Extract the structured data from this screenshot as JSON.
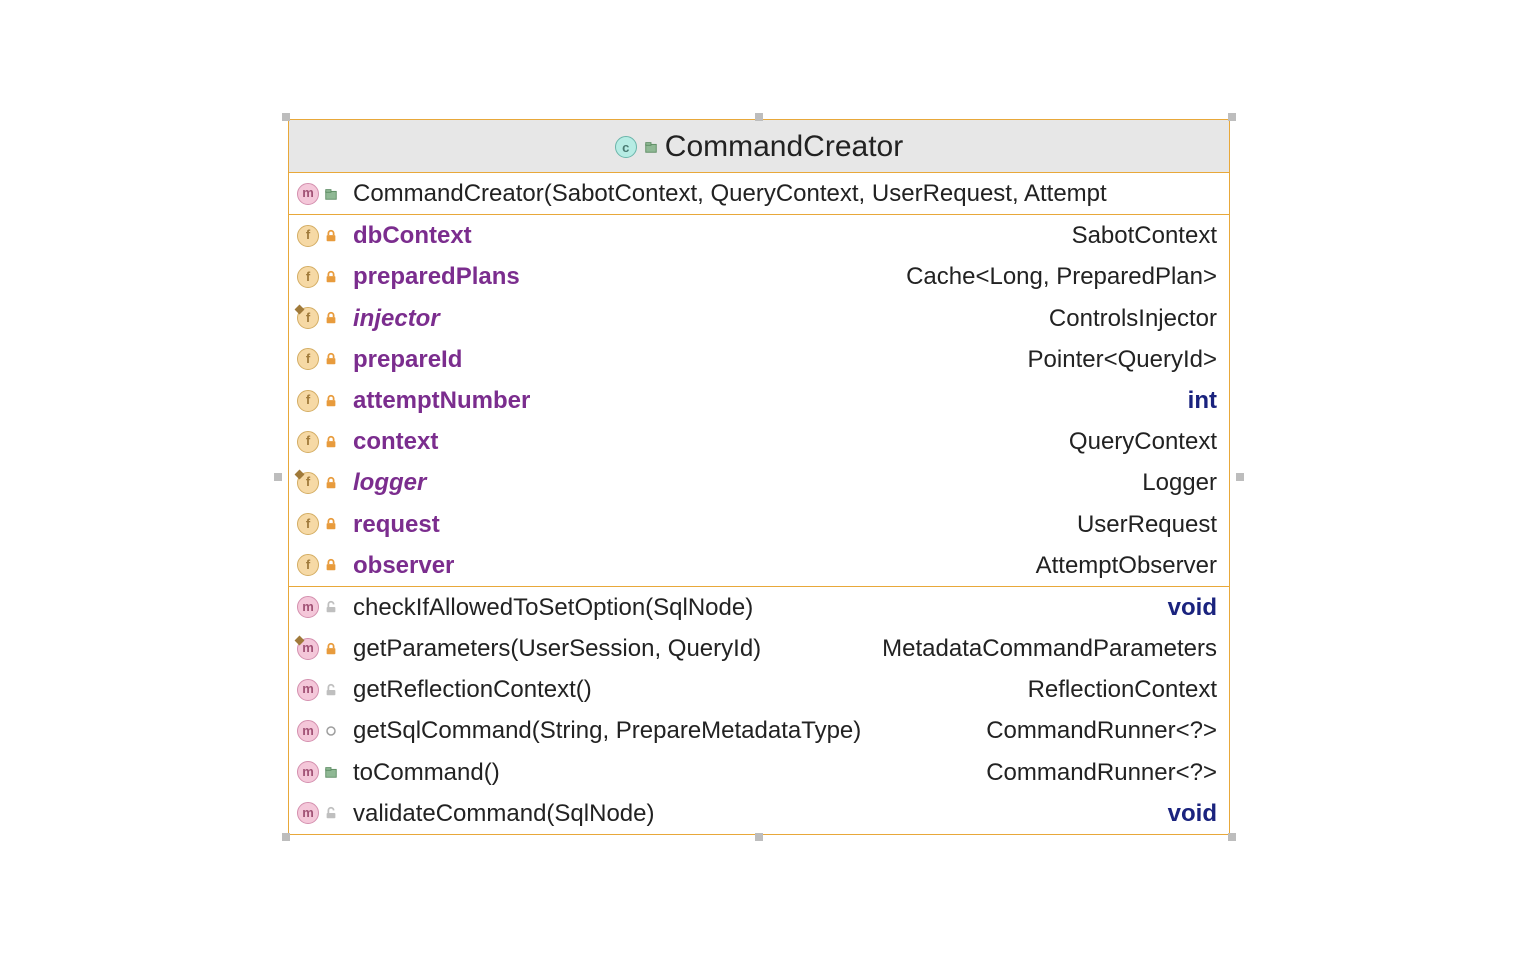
{
  "class": {
    "name": "CommandCreator",
    "kind_icon": "c"
  },
  "members": [
    {
      "icon": "m",
      "vis": "package",
      "name": "CommandCreator(SabotContext, QueryContext, UserRequest, Attempt",
      "type": "",
      "style": "method",
      "section_start": false
    },
    {
      "icon": "f",
      "vis": "lock",
      "name": "dbContext",
      "type": "SabotContext",
      "style": "field",
      "section_start": true
    },
    {
      "icon": "f",
      "vis": "lock",
      "name": "preparedPlans",
      "type": "Cache<Long, PreparedPlan>",
      "style": "field"
    },
    {
      "icon": "f",
      "vis": "lock",
      "name": "injector",
      "type": "ControlsInjector",
      "style": "field",
      "italic": true,
      "static": true
    },
    {
      "icon": "f",
      "vis": "lock",
      "name": "prepareId",
      "type": "Pointer<QueryId>",
      "style": "field"
    },
    {
      "icon": "f",
      "vis": "lock",
      "name": "attemptNumber",
      "type": "int",
      "style": "field",
      "primitive": true
    },
    {
      "icon": "f",
      "vis": "lock",
      "name": "context",
      "type": "QueryContext",
      "style": "field"
    },
    {
      "icon": "f",
      "vis": "lock",
      "name": "logger",
      "type": "Logger",
      "style": "field",
      "italic": true,
      "static": true
    },
    {
      "icon": "f",
      "vis": "lock",
      "name": "request",
      "type": "UserRequest",
      "style": "field"
    },
    {
      "icon": "f",
      "vis": "lock",
      "name": "observer",
      "type": "AttemptObserver",
      "style": "field"
    },
    {
      "icon": "m",
      "vis": "open",
      "name": "checkIfAllowedToSetOption(SqlNode)",
      "type": "void",
      "style": "method",
      "primitive": true,
      "section_start": true
    },
    {
      "icon": "m",
      "vis": "lock",
      "name": "getParameters(UserSession, QueryId)",
      "type": "MetadataCommandParameters",
      "style": "method",
      "static": true
    },
    {
      "icon": "m",
      "vis": "open",
      "name": "getReflectionContext()",
      "type": "ReflectionContext",
      "style": "method"
    },
    {
      "icon": "m",
      "vis": "circle",
      "name": "getSqlCommand(String, PrepareMetadataType)",
      "type": "CommandRunner<?>",
      "style": "method"
    },
    {
      "icon": "m",
      "vis": "package",
      "name": "toCommand()",
      "type": "CommandRunner<?>",
      "style": "method"
    },
    {
      "icon": "m",
      "vis": "open",
      "name": "validateCommand(SqlNode)",
      "type": "void",
      "style": "method",
      "primitive": true
    }
  ]
}
